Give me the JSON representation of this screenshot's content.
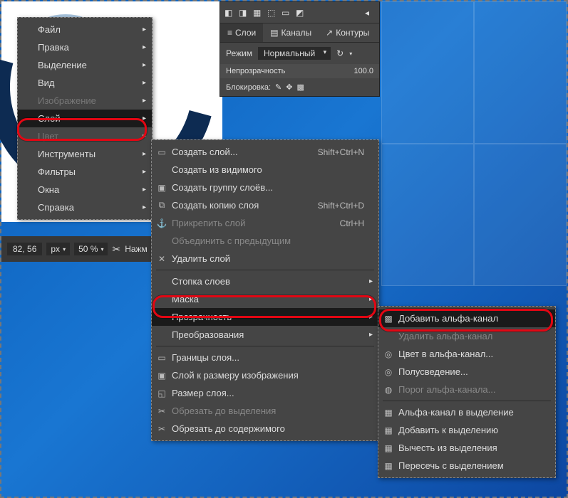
{
  "statusbar": {
    "coords": "82, 56",
    "unit": "px",
    "zoom": "50 %",
    "hint": "Нажм"
  },
  "layers_panel": {
    "tabs": [
      "Слои",
      "Каналы",
      "Контуры"
    ],
    "mode_label": "Режим",
    "mode_value": "Нормальный",
    "opacity_label": "Непрозрачность",
    "opacity_value": "100.0",
    "lock_label": "Блокировка:"
  },
  "menu1": {
    "items": [
      {
        "label": "Файл",
        "sub": true
      },
      {
        "label": "Правка",
        "sub": true
      },
      {
        "label": "Выделение",
        "sub": true
      },
      {
        "label": "Вид",
        "sub": true
      },
      {
        "label": "Изображение",
        "sub": true,
        "dim": true
      },
      {
        "label": "Слой",
        "sub": true,
        "hl": true
      },
      {
        "label": "Цвет",
        "sub": true,
        "dim": true
      },
      {
        "label": "Инструменты",
        "sub": true
      },
      {
        "label": "Фильтры",
        "sub": true
      },
      {
        "label": "Окна",
        "sub": true
      },
      {
        "label": "Справка",
        "sub": true
      }
    ]
  },
  "menu2": {
    "groups": [
      [
        {
          "label": "Создать слой...",
          "ic": "▭",
          "sc": "Shift+Ctrl+N"
        },
        {
          "label": "Создать из видимого"
        },
        {
          "label": "Создать группу слоёв...",
          "ic": "▣"
        },
        {
          "label": "Создать копию слоя",
          "ic": "⧉",
          "sc": "Shift+Ctrl+D"
        },
        {
          "label": "Прикрепить слой",
          "ic": "⚓",
          "sc": "Ctrl+H",
          "disabled": true
        },
        {
          "label": "Объединить с предыдущим",
          "disabled": true
        },
        {
          "label": "Удалить слой",
          "ic": "✕"
        }
      ],
      [
        {
          "label": "Стопка слоев",
          "sub": true
        },
        {
          "label": "Маска",
          "sub": true
        },
        {
          "label": "Прозрачность",
          "sub": true,
          "hl": true
        },
        {
          "label": "Преобразования",
          "sub": true
        }
      ],
      [
        {
          "label": "Границы слоя...",
          "ic": "▭"
        },
        {
          "label": "Слой к размеру изображения",
          "ic": "▣"
        },
        {
          "label": "Размер слоя...",
          "ic": "◱"
        },
        {
          "label": "Обрезать до выделения",
          "ic": "✂",
          "disabled": true
        },
        {
          "label": "Обрезать до содержимого",
          "ic": "✂"
        }
      ]
    ]
  },
  "menu3": {
    "groups": [
      [
        {
          "label": "Добавить альфа-канал",
          "ic": "▩",
          "hl": true
        },
        {
          "label": "Удалить альфа-канал",
          "disabled": true
        },
        {
          "label": "Цвет в альфа-канал...",
          "ic": "◎"
        },
        {
          "label": "Полусведение...",
          "ic": "◎"
        },
        {
          "label": "Порог альфа-канала...",
          "ic": "◍",
          "disabled": true
        }
      ],
      [
        {
          "label": "Альфа-канал в выделение",
          "ic": "▦"
        },
        {
          "label": "Добавить к выделению",
          "ic": "▦"
        },
        {
          "label": "Вычесть из выделения",
          "ic": "▦"
        },
        {
          "label": "Пересечь с выделением",
          "ic": "▦"
        }
      ]
    ]
  }
}
